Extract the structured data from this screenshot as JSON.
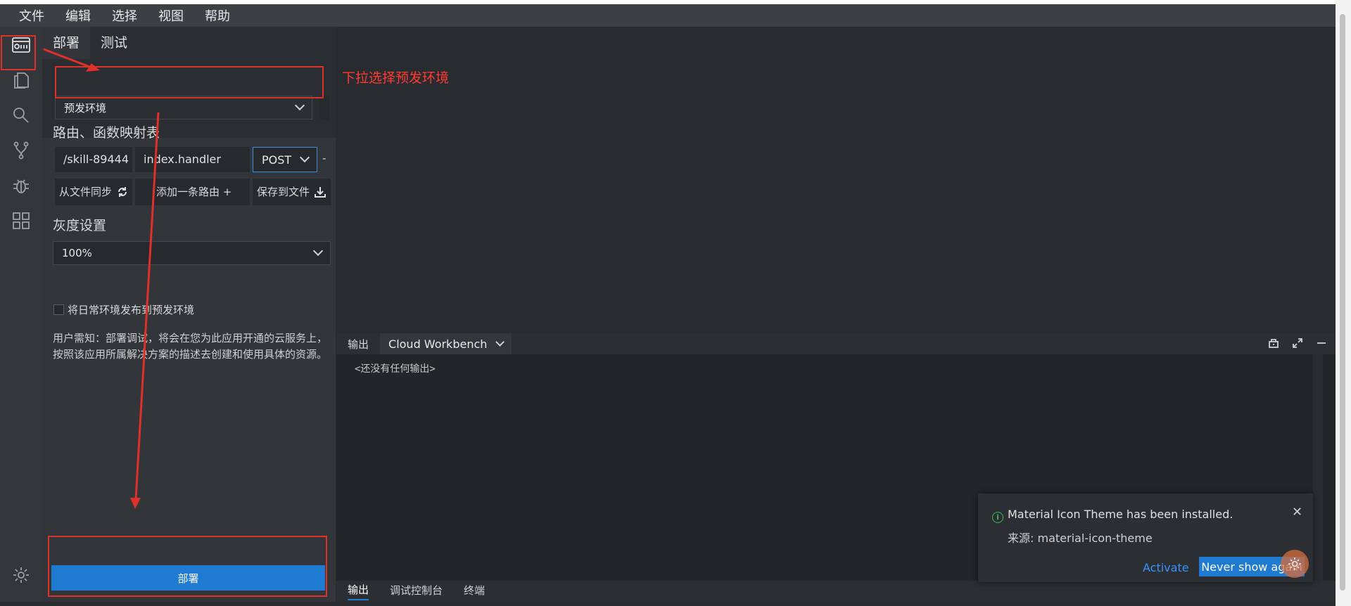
{
  "menubar": {
    "items": [
      "文件",
      "编辑",
      "选择",
      "视图",
      "帮助"
    ]
  },
  "side": {
    "tabs": [
      "部署",
      "测试"
    ],
    "environment": {
      "value": "预发环境"
    },
    "routes": {
      "title": "路由、函数映射表",
      "path": "/skill-89444",
      "handler": "index.handler",
      "method": "POST",
      "sync_button": "从文件同步",
      "add_button": "添加一条路由 +",
      "save_button": "保存到文件"
    },
    "gray": {
      "title": "灰度设置",
      "value": "100%",
      "checkbox_label": "将日常环境发布到预发环境"
    },
    "notice": "用户需知：部署调试，将会在您为此应用开通的云服务上，按照该应用所属解决方案的描述去创建和使用具体的资源。",
    "deploy_button": "部署"
  },
  "annotation": {
    "hint": "下拉选择预发环境"
  },
  "panel": {
    "label": "输出",
    "channel": "Cloud Workbench",
    "empty_text": "<还没有任何输出>",
    "bottom_tabs": [
      "输出",
      "调试控制台",
      "终端"
    ]
  },
  "toast": {
    "info_icon": "info-icon",
    "message": "Material Icon Theme has been installed.",
    "source": "来源: material-icon-theme",
    "close": "✕",
    "activate": "Activate",
    "never_show": "Never show again"
  },
  "colors": {
    "accent": "#1f7ad1",
    "annotation": "#e0302a",
    "hint_text": "#ff3b30"
  }
}
